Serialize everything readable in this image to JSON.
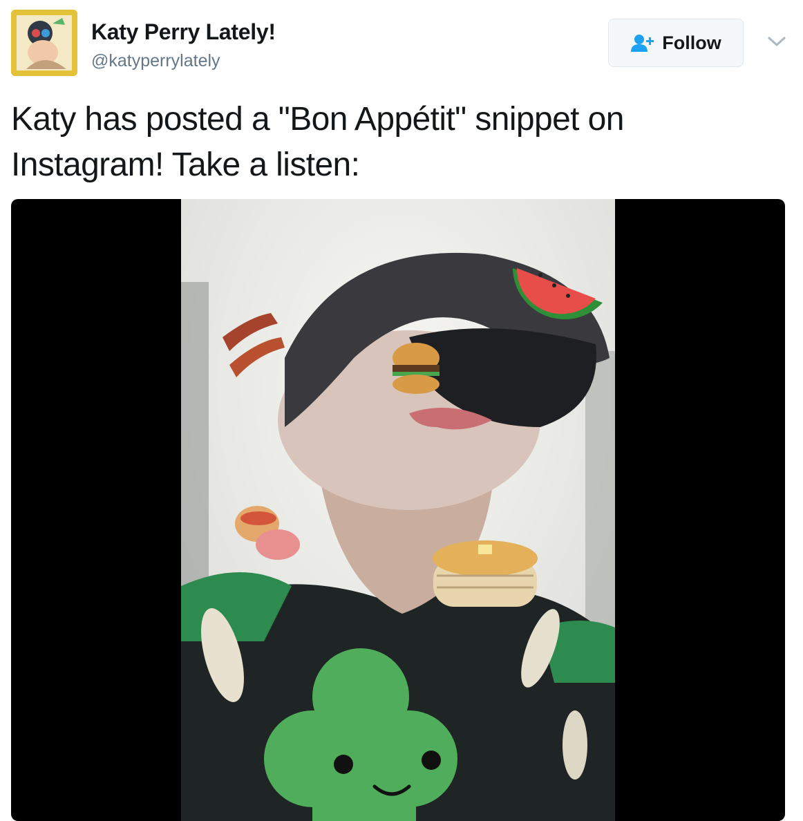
{
  "account": {
    "display_name": "Katy Perry Lately!",
    "handle": "@katyperrylately",
    "avatar_icon": "avatar-illustration-icon"
  },
  "actions": {
    "follow_label": "Follow",
    "follow_icon": "add-user-icon",
    "more_icon": "chevron-down-icon"
  },
  "tweet": {
    "text": "Katy has posted a \"Bon Appétit\" snippet on Instagram! Take a listen:"
  },
  "media": {
    "type": "video",
    "stickers": [
      "bacon-icon",
      "burger-icon",
      "watermelon-icon",
      "hotdog-icon",
      "pancakes-icon",
      "shamrock-face-icon"
    ]
  },
  "colors": {
    "text": "#14171a",
    "secondary_text": "#657786",
    "accent": "#1da1f2",
    "button_bg": "#f5f8fa",
    "avatar_bg": "#e3c23a",
    "media_bg": "#000000"
  }
}
